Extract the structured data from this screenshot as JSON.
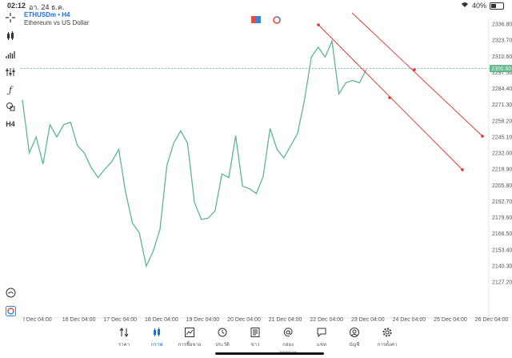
{
  "status_bar": {
    "time": "02:12",
    "date": "อา. 24 ธ.ค.",
    "battery": "40%",
    "battery_level": 0.4
  },
  "symbol": {
    "name": "ETHUSDm • H4",
    "description": "Ethereum vs US Dollar"
  },
  "left_tools": [
    "crosshair-icon",
    "candles-icon",
    "indicators-icon",
    "adjust-icon",
    "function-icon",
    "shapes-icon",
    "timeframe-label"
  ],
  "timeframe": "H4",
  "price_tag": "2300.60",
  "y_ticks": [
    "2336.80",
    "2323.70",
    "2310.60",
    "2297.50",
    "2284.40",
    "2271.30",
    "2258.20",
    "2245.10",
    "2232.00",
    "2218.90",
    "2205.80",
    "2192.70",
    "2179.60",
    "2166.50",
    "2153.40",
    "2140.30",
    "2127.20"
  ],
  "x_ticks": [
    "l Dec 04:00",
    "16 Dec 04:00",
    "17 Dec 04:00",
    "18 Dec 04:00",
    "19 Dec 04:00",
    "20 Dec 04:00",
    "21 Dec 04:00",
    "22 Dec 04:00",
    "23 Dec 04:00",
    "24 Dec 04:00",
    "25 Dec 04:00",
    "26 Dec 04:00"
  ],
  "chart_data": {
    "type": "line",
    "series": [
      {
        "values": [
          2275,
          2232,
          2245,
          2223,
          2255,
          2245,
          2255,
          2257,
          2238,
          2232,
          2220,
          2212,
          2219,
          2225,
          2235,
          2200,
          2175,
          2167,
          2140,
          2152,
          2170,
          2222,
          2240,
          2250,
          2240,
          2192,
          2178,
          2179,
          2185,
          2215,
          2212,
          2246,
          2205,
          2203,
          2199,
          2213,
          2252,
          2235,
          2228,
          2238,
          2248,
          2275,
          2310,
          2318,
          2310,
          2323,
          2280,
          2289,
          2291,
          2289,
          2300
        ]
      }
    ],
    "line_color": "#5db88a",
    "current_price": 2300.6,
    "ylim": [
      2120,
      2345
    ],
    "trendlines_color": "#e03030"
  },
  "tabs": [
    {
      "label": "ราคา",
      "icon": "quotes-icon"
    },
    {
      "label": "กราฟ",
      "icon": "chart-icon",
      "active": true
    },
    {
      "label": "การซื้อขาย",
      "icon": "trade-icon"
    },
    {
      "label": "ประวัติ",
      "icon": "history-icon"
    },
    {
      "label": "ข่าว",
      "icon": "news-icon"
    },
    {
      "label": "กล่องจดหมาย",
      "icon": "mailbox-icon"
    },
    {
      "label": "แชท",
      "icon": "chat-icon"
    },
    {
      "label": "บัญชี",
      "icon": "account-icon"
    },
    {
      "label": "การตั้งค่า",
      "icon": "settings-icon"
    }
  ]
}
